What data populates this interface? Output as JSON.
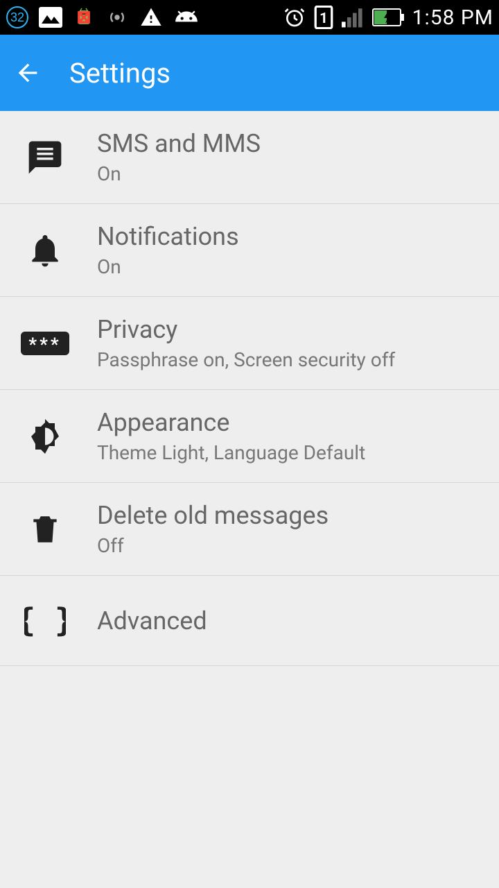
{
  "status": {
    "time": "1:58 PM",
    "badge": "32",
    "sim": "1"
  },
  "header": {
    "title": "Settings"
  },
  "items": [
    {
      "title": "SMS and MMS",
      "sub": "On"
    },
    {
      "title": "Notifications",
      "sub": "On"
    },
    {
      "title": "Privacy",
      "sub": "Passphrase on, Screen security off"
    },
    {
      "title": "Appearance",
      "sub": "Theme Light, Language Default"
    },
    {
      "title": "Delete old messages",
      "sub": "Off"
    },
    {
      "title": "Advanced",
      "sub": ""
    }
  ]
}
